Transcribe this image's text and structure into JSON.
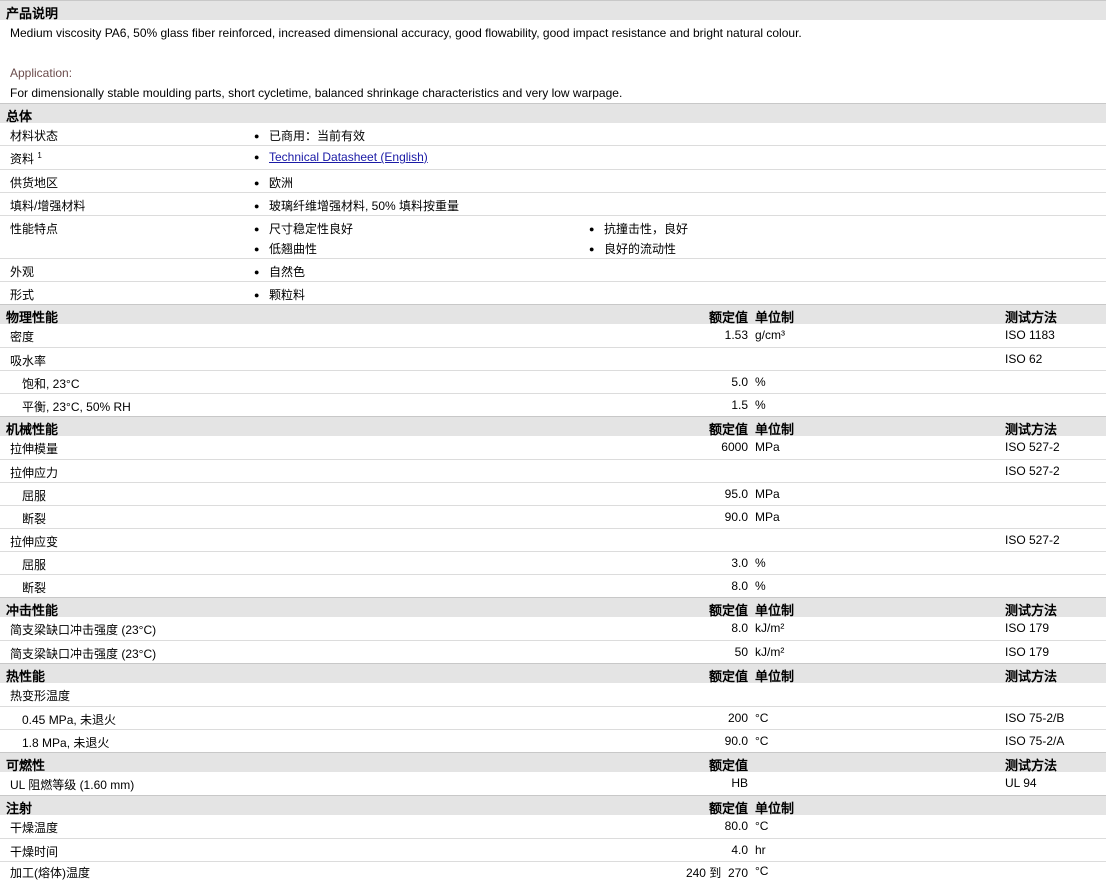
{
  "product_description": {
    "heading": "产品说明",
    "text": "Medium viscosity PA6, 50% glass fiber reinforced, increased dimensional accuracy, good flowability, good impact resistance and bright natural colour.",
    "application_label": "Application:",
    "application_text": "For dimensionally stable moulding parts, short cycletime, balanced shrinkage characteristics and very low warpage."
  },
  "general": {
    "heading": "总体",
    "rows": [
      {
        "label": "材料状态",
        "items": [
          "已商用：当前有效"
        ]
      },
      {
        "label": "资料",
        "sup": "1",
        "items": [
          "Technical Datasheet (English)"
        ]
      },
      {
        "label": "供货地区",
        "items": [
          "欧洲"
        ]
      },
      {
        "label": "填料/增强材料",
        "items": [
          "玻璃纤维增强材料, 50% 填料按重量"
        ]
      },
      {
        "label": "性能特点",
        "items": [
          "尺寸稳定性良好",
          "抗撞击性，良好",
          "低翘曲性",
          "良好的流动性"
        ]
      },
      {
        "label": "外观",
        "items": [
          "自然色"
        ]
      },
      {
        "label": "形式",
        "items": [
          "颗粒料"
        ]
      }
    ]
  },
  "columns": {
    "value": "额定值",
    "unit": "单位制",
    "method": "测试方法"
  },
  "physical": {
    "heading": "物理性能",
    "rows": [
      {
        "label": "密度",
        "value": "1.53",
        "unit": "g/cm³",
        "method": "ISO 1183"
      },
      {
        "label": "吸水率",
        "value": "",
        "unit": "",
        "method": "ISO 62"
      },
      {
        "label": "饱和, 23°C",
        "value": "5.0",
        "unit": "%",
        "method": ""
      },
      {
        "label": "平衡, 23°C, 50% RH",
        "value": "1.5",
        "unit": "%",
        "method": ""
      }
    ]
  },
  "mechanical": {
    "heading": "机械性能",
    "rows": [
      {
        "label": "拉伸模量",
        "value": "6000",
        "unit": "MPa",
        "method": "ISO 527-2"
      },
      {
        "label": "拉伸应力",
        "value": "",
        "unit": "",
        "method": "ISO 527-2"
      },
      {
        "label": "屈服",
        "value": "95.0",
        "unit": "MPa",
        "method": ""
      },
      {
        "label": "断裂",
        "value": "90.0",
        "unit": "MPa",
        "method": ""
      },
      {
        "label": "拉伸应变",
        "value": "",
        "unit": "",
        "method": "ISO 527-2"
      },
      {
        "label": "屈服",
        "value": "3.0",
        "unit": "%",
        "method": ""
      },
      {
        "label": "断裂",
        "value": "8.0",
        "unit": "%",
        "method": ""
      }
    ]
  },
  "impact": {
    "heading": "冲击性能",
    "rows": [
      {
        "label": "简支梁缺口冲击强度 (23°C)",
        "value": "8.0",
        "unit": "kJ/m²",
        "method": "ISO 179"
      },
      {
        "label": "简支梁缺口冲击强度 (23°C)",
        "value": "50",
        "unit": "kJ/m²",
        "method": "ISO 179"
      }
    ]
  },
  "thermal": {
    "heading": "热性能",
    "rows": [
      {
        "label": "热变形温度",
        "value": "",
        "unit": "",
        "method": ""
      },
      {
        "label": "0.45 MPa, 未退火",
        "value": "200",
        "unit": "°C",
        "method": "ISO 75-2/B"
      },
      {
        "label": "1.8 MPa, 未退火",
        "value": "90.0",
        "unit": "°C",
        "method": "ISO 75-2/A"
      }
    ]
  },
  "flammability": {
    "heading": "可燃性",
    "rows": [
      {
        "label": "UL 阻燃等级 (1.60 mm)",
        "value": "HB",
        "unit": "",
        "method": "UL 94"
      }
    ]
  },
  "injection": {
    "heading": "注射",
    "rows": [
      {
        "label": "干燥温度",
        "value": "80.0",
        "unit": "°C",
        "method": ""
      },
      {
        "label": "干燥时间",
        "value": "4.0",
        "unit": "hr",
        "method": ""
      },
      {
        "label": "加工(熔体)温度",
        "value": "240 到  270",
        "unit": "°C",
        "method": ""
      }
    ]
  }
}
